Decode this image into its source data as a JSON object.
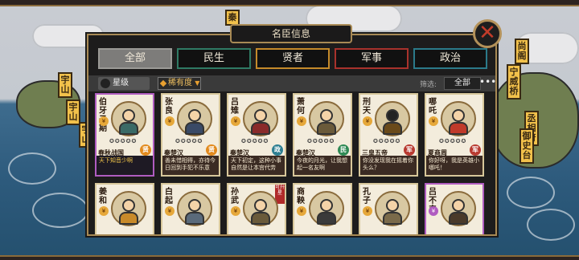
{
  "panel": {
    "title": "名臣信息",
    "close_icon": "close-icon"
  },
  "tabs": [
    {
      "label": "全部",
      "active": true
    },
    {
      "label": "民生",
      "active": false
    },
    {
      "label": "贤者",
      "active": false
    },
    {
      "label": "军事",
      "active": false
    },
    {
      "label": "政治",
      "active": false
    }
  ],
  "filter": {
    "sort_label": "星级",
    "dropdown_label": "稀有度",
    "screen_label": "筛选:",
    "filter_value": "全部",
    "more": "•••"
  },
  "colors": {
    "badge_xian": "#e28a1e",
    "badge_zheng": "#2e7f92",
    "badge_min": "#2f8a55",
    "badge_jun": "#b83a30",
    "accent_border": "#a88a55"
  },
  "cards": [
    {
      "name": "伯牙子期",
      "origin": "春秋战国",
      "badge": "贤",
      "badge_type": "xian",
      "quote": "天下知音少啊",
      "selected": true
    },
    {
      "name": "张良",
      "origin": "秦楚汉",
      "badge": "贤",
      "badge_type": "xian",
      "quote": "善未惜相得，亦待今日回到手犯不乐意",
      "selected": false
    },
    {
      "name": "吕雉",
      "origin": "秦楚汉",
      "badge": "政",
      "badge_type": "zheng",
      "quote": "天下初定，这种小事自然是让本宫代劳",
      "selected": false
    },
    {
      "name": "萧何",
      "origin": "秦楚汉",
      "badge": "民",
      "badge_type": "min",
      "quote": "今夜的月光，让我想起一名友啊",
      "selected": false
    },
    {
      "name": "刑天",
      "origin": "三皇五帝",
      "badge": "军",
      "badge_type": "jun",
      "quote": "你没发现我在摇着你头么？",
      "selected": false
    },
    {
      "name": "哪吒",
      "origin": "夏商周",
      "badge": "军",
      "badge_type": "jun",
      "quote": "你好呀，我是英雄小哪吒！",
      "selected": false
    },
    {
      "name": "姜和",
      "origin": "",
      "badge": "",
      "badge_type": "",
      "quote": "",
      "selected": false
    },
    {
      "name": "白起",
      "origin": "",
      "badge": "",
      "badge_type": "",
      "quote": "",
      "selected": false
    },
    {
      "name": "孙武",
      "origin": "",
      "badge": "",
      "badge_type": "",
      "quote": "",
      "selected": false,
      "tag": "可升星"
    },
    {
      "name": "商鞅",
      "origin": "",
      "badge": "",
      "badge_type": "",
      "quote": "",
      "selected": false
    },
    {
      "name": "孔子",
      "origin": "",
      "badge": "",
      "badge_type": "",
      "quote": "",
      "selected": false
    },
    {
      "name": "吕不韦",
      "origin": "",
      "badge": "",
      "badge_type": "",
      "quote": "",
      "selected": true
    }
  ],
  "background_signs": [
    "宇山",
    "宇山",
    "宇山",
    "秦",
    "尚阁",
    "宁威桥",
    "丞相府",
    "御史台"
  ]
}
